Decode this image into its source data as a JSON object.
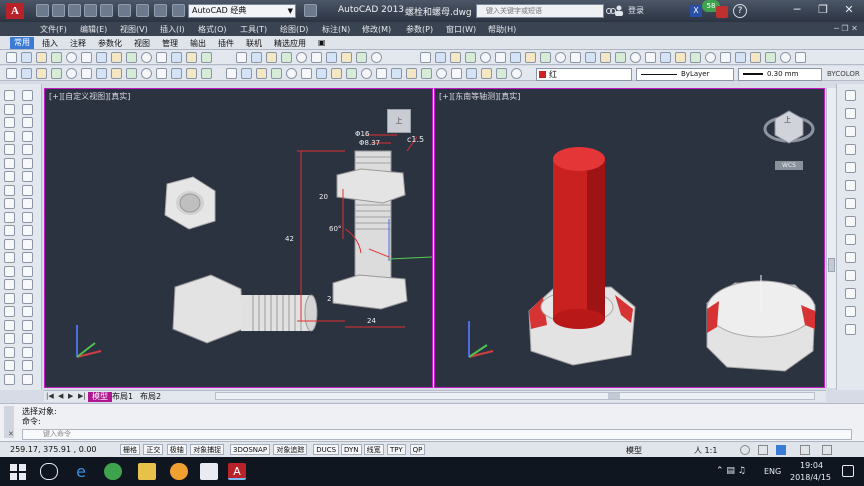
{
  "title_bar": {
    "app_logo": "A",
    "workspace": "AutoCAD 经典",
    "app_title": "AutoCAD 2013",
    "file_title": "螺栓和螺母.dwg",
    "search_placeholder": "键入关键字或短语",
    "login_label": "登录",
    "notification_count": "58",
    "help_label": "?"
  },
  "menu": {
    "items": [
      "文件(F)",
      "编辑(E)",
      "视图(V)",
      "插入(I)",
      "格式(O)",
      "工具(T)",
      "绘图(D)",
      "标注(N)",
      "修改(M)",
      "参数(P)",
      "窗口(W)",
      "帮助(H)"
    ]
  },
  "ribbon": {
    "tabs": [
      "常用",
      "插入",
      "注释",
      "参数化",
      "视图",
      "管理",
      "输出",
      "插件",
      "联机",
      "精选应用"
    ],
    "active_tab": 0
  },
  "properties": {
    "layer": "红",
    "layer_color": "#d12020",
    "linetype": "ByLayer",
    "lineweight": "0.30 mm",
    "plot_style": "BYCOLOR"
  },
  "viewports": {
    "left_label": "[+][自定义视图][真实]",
    "right_label": "[+][东南等轴测][真实]",
    "border_color": "#c21ec8",
    "background": "#2b3240",
    "viewcube_left_top": "上",
    "viewcube_right_top": "上",
    "wcs_label": "WCS"
  },
  "dimensions": {
    "phi16": "Φ16",
    "phi37": "Φ8.37",
    "c15": "c1.5",
    "d20": "20",
    "d60": "60°",
    "d42": "42",
    "d24": "24",
    "d2": "2"
  },
  "layout_tabs": [
    "模型",
    "布局1",
    "布局2"
  ],
  "command": {
    "line1": "选择对象:",
    "line2": "命令:",
    "input_placeholder": "键入命令"
  },
  "status": {
    "coords": "259.17,  375.91 , 0.00",
    "buttons": [
      "栅格",
      "正交",
      "极轴",
      "对象捕捉",
      "3DOSNAP",
      "对象追踪",
      "DUCS",
      "DYN",
      "线宽",
      "TPY",
      "QP"
    ],
    "model": "模型",
    "scale": "人 1:1"
  },
  "taskbar": {
    "language": "ENG",
    "time": "19:04",
    "date": "2018/4/15"
  }
}
